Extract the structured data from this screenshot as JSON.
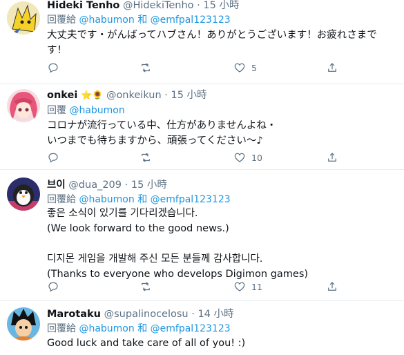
{
  "tweets": [
    {
      "name": "Hideki Tenho",
      "handle": "@HidekiTenho",
      "time": "15 小時",
      "reply_prefix": "回覆給",
      "reply_mentions": [
        "@habumon",
        "@emfpal123123"
      ],
      "reply_joiner": "和",
      "text": "大丈夫です・がんばってハブさん！ありがとうございます！お疲れさまで\nす！",
      "likes": "5",
      "retweets": "",
      "avatar_icon": "yellow-creature-avatar"
    },
    {
      "name": "onkei",
      "name_emoji": "⭐🌻",
      "handle": "@onkeikun",
      "time": "15 小時",
      "reply_prefix": "回覆",
      "reply_mentions": [
        "@habumon"
      ],
      "text": "コロナが流行っている中、仕方がありませんよね・\nいつまでも待ちますから、頑張ってください～♪",
      "likes": "10",
      "avatar_icon": "pink-hair-avatar"
    },
    {
      "name": "브이",
      "handle": "@dua_209",
      "time": "15 小時",
      "reply_prefix": "回覆給",
      "reply_mentions": [
        "@habumon",
        "@emfpal123123"
      ],
      "reply_joiner": "和",
      "text": "좋은 소식이 있기를 기다리겠습니다.\n(We look forward to the good news.)\n\n디지몬 게임을 개발해 주신 모든 분들께 감사합니다.\n(Thanks to everyone who develops Digimon games)",
      "likes": "11",
      "avatar_icon": "penguin-avatar"
    },
    {
      "name": "Marotaku",
      "handle": "@supalinocelosu",
      "time": "14 小時",
      "reply_prefix": "回覆給",
      "reply_mentions": [
        "@habumon",
        "@emfpal123123"
      ],
      "reply_joiner": "和",
      "text": "Good luck and take care of all of you! :)",
      "avatar_icon": "anime-boy-avatar"
    }
  ],
  "dot": "·",
  "colors": {
    "link": "#1b95e0",
    "muted": "#5b7083",
    "border": "#e6ecf0"
  }
}
